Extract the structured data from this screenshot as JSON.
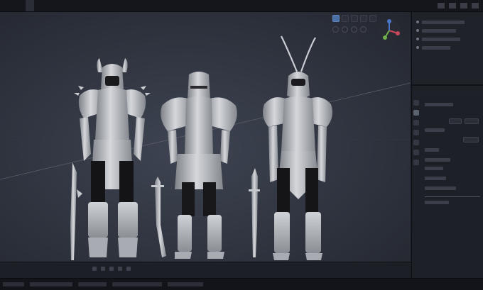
{
  "menu": {
    "items": [
      "",
      "",
      "",
      "",
      "",
      "",
      "",
      "",
      "",
      "",
      "",
      ""
    ]
  },
  "viewport": {
    "mode_info_line1": "",
    "mode_info_line2": ""
  },
  "timeline": {
    "current_frame": ""
  },
  "colors": {
    "viewport_bg": "#333844",
    "panel_bg": "#1f2128",
    "header_bg": "#15161b",
    "accent": "#4a6fa5",
    "gizmo_x": "#c8475a",
    "gizmo_y": "#6fb04c",
    "gizmo_z": "#4a78c8",
    "armor": "#b5b8bd"
  },
  "scene": {
    "objects": [
      "horned-knight-model",
      "helmet-knight-model",
      "antenna-knight-model",
      "sword-left",
      "sword-middle",
      "sword-right"
    ]
  },
  "icons": [
    "viewport-gizmo-icon",
    "select-tool-icon",
    "move-tool-icon",
    "view-shading-icon",
    "outliner-visibility-icon",
    "properties-tab-icon"
  ]
}
